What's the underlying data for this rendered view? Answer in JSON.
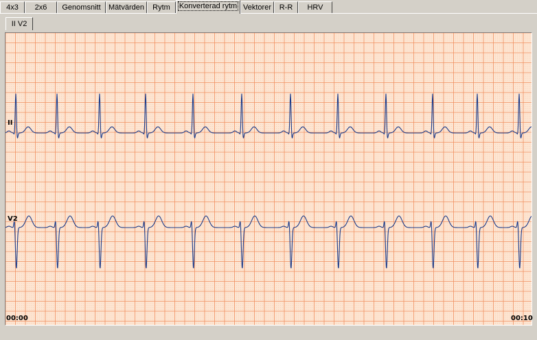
{
  "tabs": [
    {
      "label": "4x3",
      "active": false
    },
    {
      "label": "2x6",
      "active": false
    },
    {
      "label": "Genomsnitt",
      "active": false
    },
    {
      "label": "Mätvärden",
      "active": false
    },
    {
      "label": "Rytm",
      "active": false
    },
    {
      "label": "Konverterad rytm",
      "active": true
    },
    {
      "label": "Vektorer",
      "active": false
    },
    {
      "label": "R-R",
      "active": false
    },
    {
      "label": "HRV",
      "active": false
    }
  ],
  "subtab": {
    "label": "II V2"
  },
  "leads": [
    {
      "name": "II"
    },
    {
      "name": "V2"
    }
  ],
  "time": {
    "start": "00:00",
    "end": "00:10"
  },
  "colors": {
    "grid_bg": "#fde5d2",
    "grid_minor": "#f7b48a",
    "grid_major": "#f09060",
    "trace": "#1a3a8a"
  }
}
